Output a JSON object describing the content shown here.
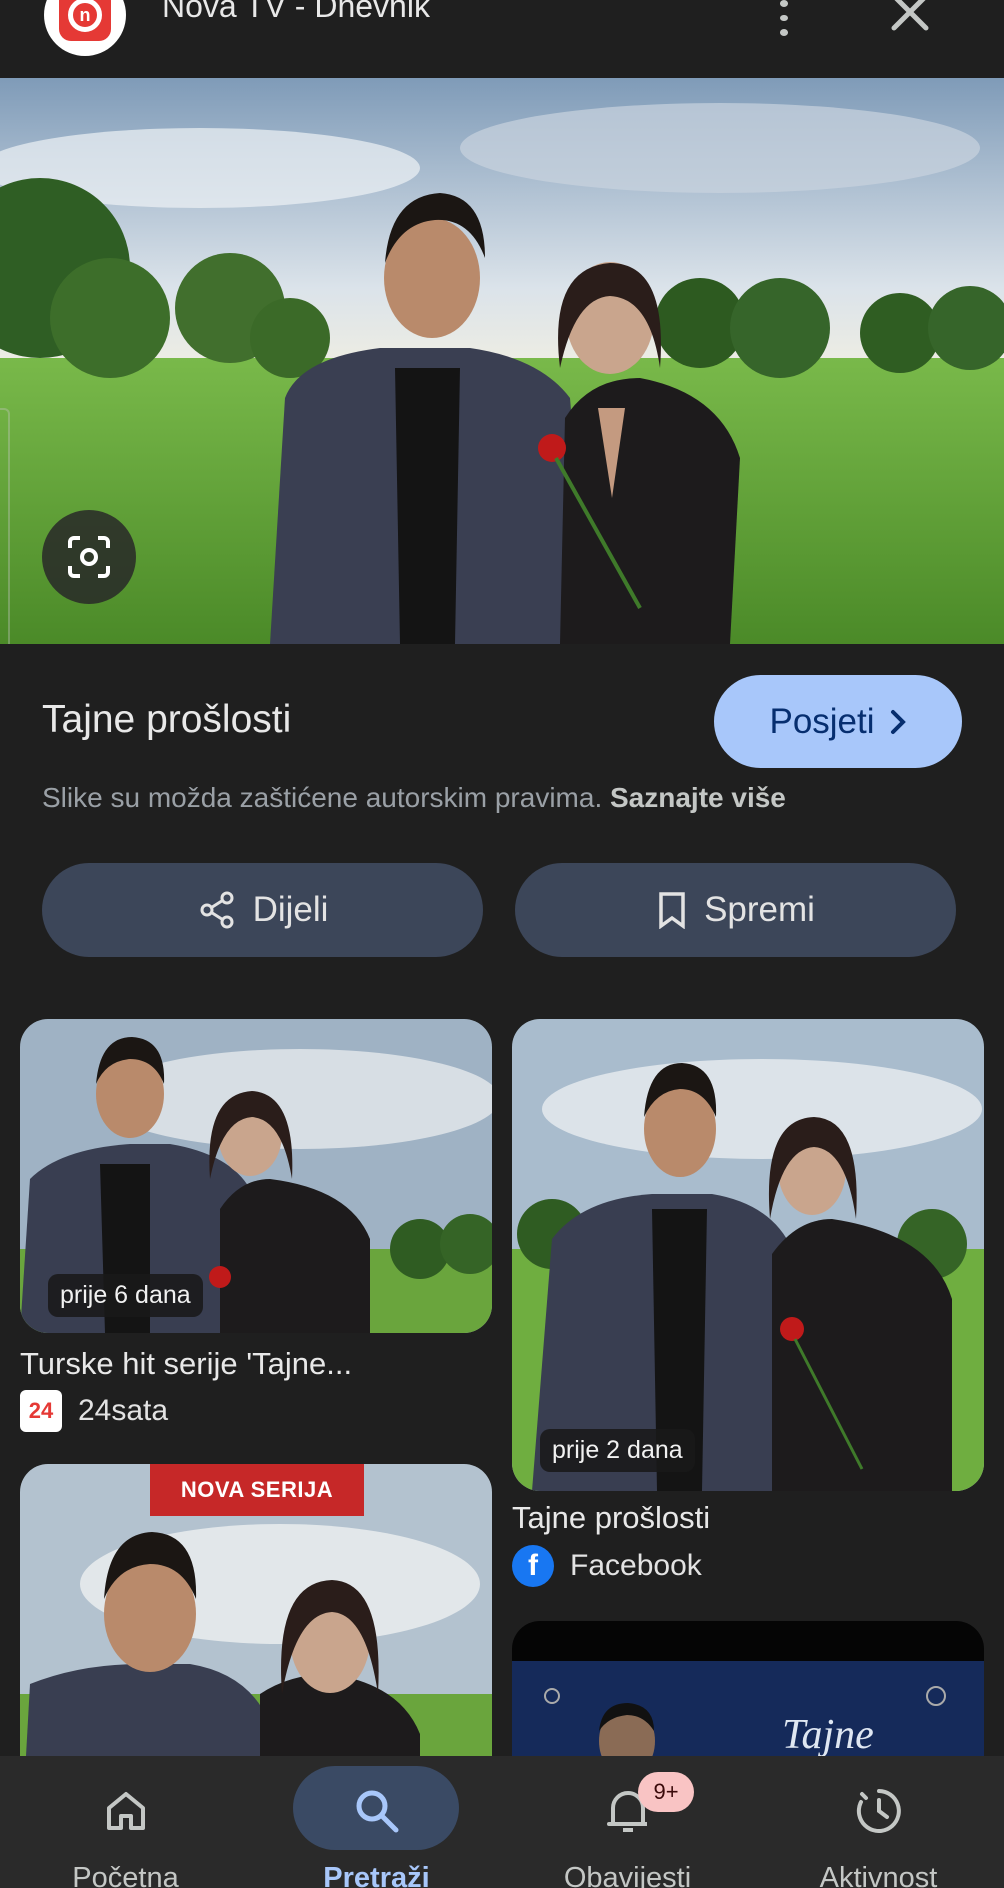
{
  "header": {
    "site_name": "Nova TV - Dnevnik",
    "logo_letter": "n"
  },
  "result": {
    "title": "Tajne prošlosti",
    "visit_label": "Posjeti",
    "copyright_text": "Slike su možda zaštićene autorskim pravima.",
    "learn_more": "Saznajte više"
  },
  "actions": {
    "share_label": "Dijeli",
    "save_label": "Spremi"
  },
  "related": [
    {
      "time": "prije 6 dana",
      "title": "Turske hit serije 'Tajne...",
      "source": "24sata",
      "source_icon_text": "24"
    },
    {
      "time": "prije 2 dana",
      "title": "Tajne prošlosti",
      "source": "Facebook",
      "source_icon_text": "f"
    },
    {
      "badge": "NOVA SERIJA"
    },
    {
      "overlay_text": "Tajne"
    }
  ],
  "bottom_nav": {
    "items": [
      {
        "label": "Početna",
        "icon": "home-icon"
      },
      {
        "label": "Pretraži",
        "icon": "search-icon",
        "active": true
      },
      {
        "label": "Obavijesti",
        "icon": "bell-icon",
        "badge": "9+"
      },
      {
        "label": "Aktivnost",
        "icon": "activity-icon"
      }
    ]
  },
  "colors": {
    "background": "#1f1f1f",
    "visit_button": "#a8c7fa",
    "pill_button": "#3c4659",
    "nav_active": "#3a4a64"
  }
}
